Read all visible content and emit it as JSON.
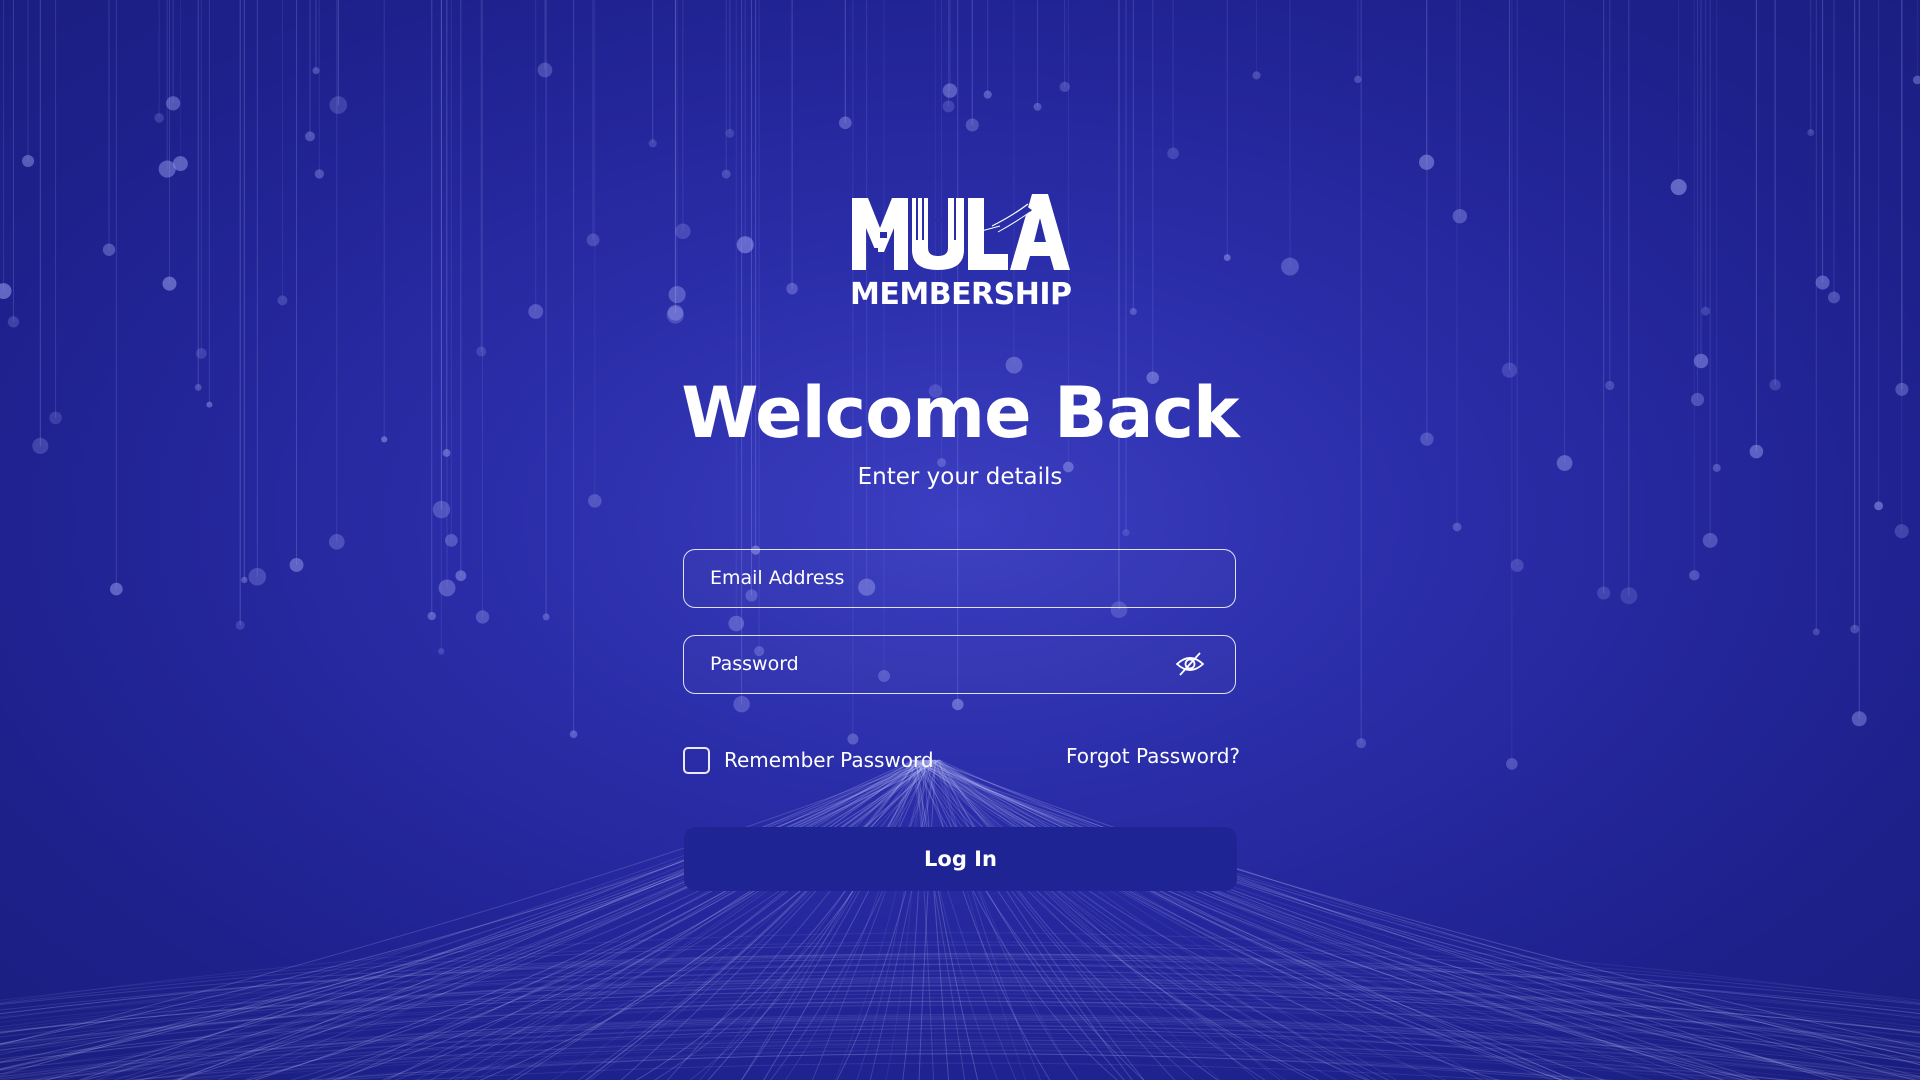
{
  "logo": {
    "subtitle": "MEMBERSHIP",
    "wordmark": "MULA"
  },
  "title": "Welcome Back",
  "subtitle": "Enter your details",
  "form": {
    "email_placeholder": "Email Address",
    "email_value": "",
    "password_placeholder": "Password",
    "password_value": "",
    "password_toggle_icon": "eye-off-icon",
    "remember_label": "Remember Password",
    "remember_checked": false,
    "forgot_label": "Forgot Password?",
    "login_label": "Log In"
  },
  "colors": {
    "background": "#2a2da8",
    "button": "#1e2494",
    "text": "#ffffff"
  }
}
